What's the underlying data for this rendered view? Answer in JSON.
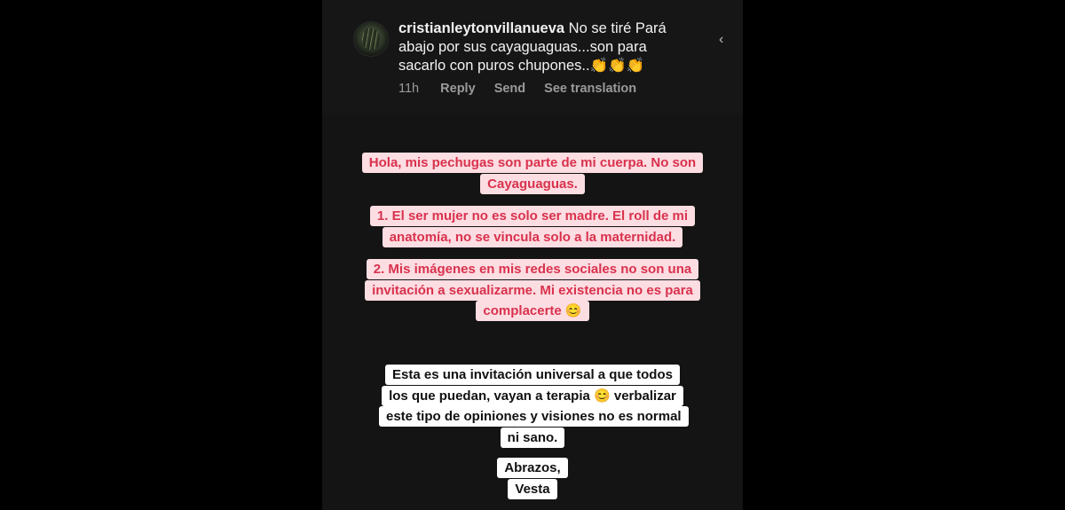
{
  "comment": {
    "username": "cristianleytonvillanueva",
    "text": "No se tiré Pará abajo por sus cayaguaguas...son para sacarlo con puros chupones..👏👏👏",
    "time": "11h",
    "reply_label": "Reply",
    "send_label": "Send",
    "translate_label": "See translation"
  },
  "story_text": {
    "pink": [
      "Hola, mis pechugas son parte de mi cuerpa. No son Cayaguaguas.",
      "1. El ser mujer no es solo ser madre. El roll de mi anatomía, no se vincula solo a la maternidad.",
      "2. Mis imágenes en mis redes sociales no son una invitación a sexualizarme. Mi existencia no es para complacerte 😊"
    ],
    "white": [
      "Esta es una invitación universal a que todos los que puedan, vayan a terapia 😊 verbalizar este tipo de opiniones y visiones no es normal ni sano.",
      "Abrazos, Vesta"
    ]
  },
  "icons": {
    "chevron": "chevron-left-icon",
    "avatar": "user-avatar"
  },
  "colors": {
    "pink_bg": "#fcdde2",
    "pink_text": "#d9324d",
    "dark_bg": "#141414"
  }
}
